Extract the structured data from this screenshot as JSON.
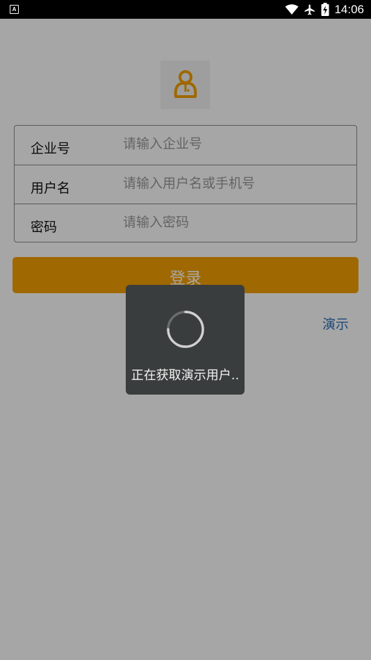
{
  "status_bar": {
    "time": "14:06",
    "notification_icon_letter": "A",
    "icons": [
      "wifi-icon",
      "airplane-icon",
      "battery-charging-icon"
    ]
  },
  "logo": {
    "icon": "user-icon",
    "color": "#f5a000"
  },
  "form": {
    "company": {
      "label": "企业号",
      "placeholder": "请输入企业号",
      "value": ""
    },
    "username": {
      "label": "用户名",
      "placeholder": "请输入用户名或手机号",
      "value": ""
    },
    "password": {
      "label": "密码",
      "placeholder": "请输入密码",
      "value": ""
    }
  },
  "login_button": {
    "label": "登录",
    "color": "#f5a000"
  },
  "demo_link": {
    "label": "演示",
    "color": "#2b6fb8"
  },
  "progress_dialog": {
    "message": "正在获取演示用户.."
  }
}
